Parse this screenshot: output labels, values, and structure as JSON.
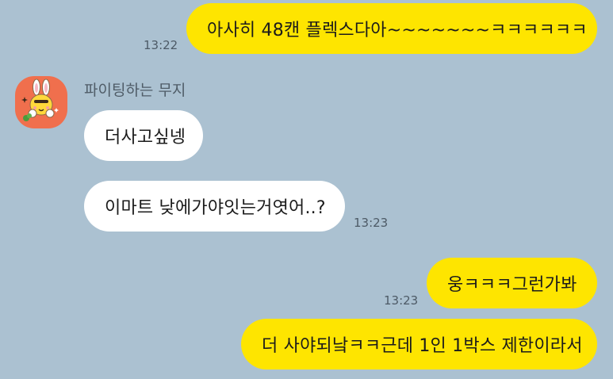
{
  "chat": {
    "sender_name": "파이팅하는 무지",
    "messages": [
      {
        "direction": "outgoing",
        "text": "아사히 48캔 플렉스다아~~~~~~~ㅋㅋㅋㅋㅋㅋ",
        "time": "13:22"
      },
      {
        "direction": "incoming",
        "text": "더사고싶넹",
        "time": ""
      },
      {
        "direction": "incoming",
        "text": "이마트 낮에가야잇는거엿어..?",
        "time": "13:23"
      },
      {
        "direction": "outgoing",
        "text": "웅ㅋㅋㅋ그런가봐",
        "time": "13:23"
      },
      {
        "direction": "outgoing",
        "text": "더 사야되낰ㅋㅋ근데 1인 1박스 제한이라서",
        "time": ""
      }
    ]
  },
  "colors": {
    "background": "#abc1d1",
    "outgoing_bubble": "#fee500",
    "incoming_bubble": "#ffffff",
    "avatar_background": "#f06f4d"
  },
  "avatar": {
    "icon": "muzi-character-icon"
  }
}
